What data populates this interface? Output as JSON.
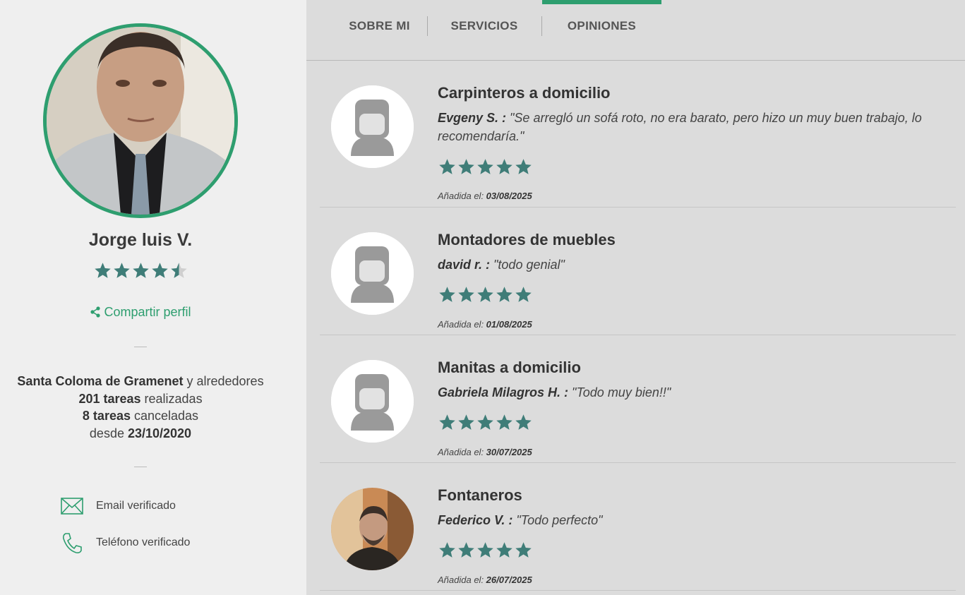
{
  "profile": {
    "name": "Jorge luis V.",
    "rating": 4.5,
    "rating_max": 5,
    "share_label": "Compartir perfil",
    "location": "Santa Coloma de Gramenet",
    "location_suffix": " y alrededores",
    "tasks_done": "201 tareas",
    "tasks_done_suffix": " realizadas",
    "tasks_cancelled": "8 tareas",
    "tasks_cancelled_suffix": " canceladas",
    "since_prefix": "desde ",
    "since_date": "23/10/2020",
    "verifications": [
      {
        "label": "Email verificado",
        "icon": "envelope-icon"
      },
      {
        "label": "Teléfono verificado",
        "icon": "phone-icon"
      }
    ]
  },
  "tabs": [
    {
      "label": "SOBRE MI",
      "active": false
    },
    {
      "label": "SERVICIOS",
      "active": false
    },
    {
      "label": "OPINIONES",
      "active": true
    }
  ],
  "reviews": [
    {
      "title": "Carpinteros a domicilio",
      "author": "Evgeny S. :",
      "text": " \"Se arregló un sofá roto, no era barato, pero hizo un muy buen trabajo, lo recomendaría.\"",
      "rating": 5,
      "date_label": "Añadida el: ",
      "date": "03/08/2025",
      "avatar": "placeholder"
    },
    {
      "title": "Montadores de muebles",
      "author": "david r. :",
      "text": " \"todo genial\"",
      "rating": 5,
      "date_label": "Añadida el: ",
      "date": "01/08/2025",
      "avatar": "placeholder"
    },
    {
      "title": "Manitas a domicilio",
      "author": "Gabriela Milagros H. :",
      "text": " \"Todo muy bien!!\"",
      "rating": 5,
      "date_label": "Añadida el: ",
      "date": "30/07/2025",
      "avatar": "placeholder"
    },
    {
      "title": "Fontaneros",
      "author": "Federico V. :",
      "text": " \"Todo perfecto\"",
      "rating": 5,
      "date_label": "Añadida el: ",
      "date": "26/07/2025",
      "avatar": "photo"
    }
  ],
  "colors": {
    "accent": "#2e9e6f",
    "star": "#3f7d78",
    "panel": "#efefef",
    "content_bg": "#dcdcdc"
  }
}
